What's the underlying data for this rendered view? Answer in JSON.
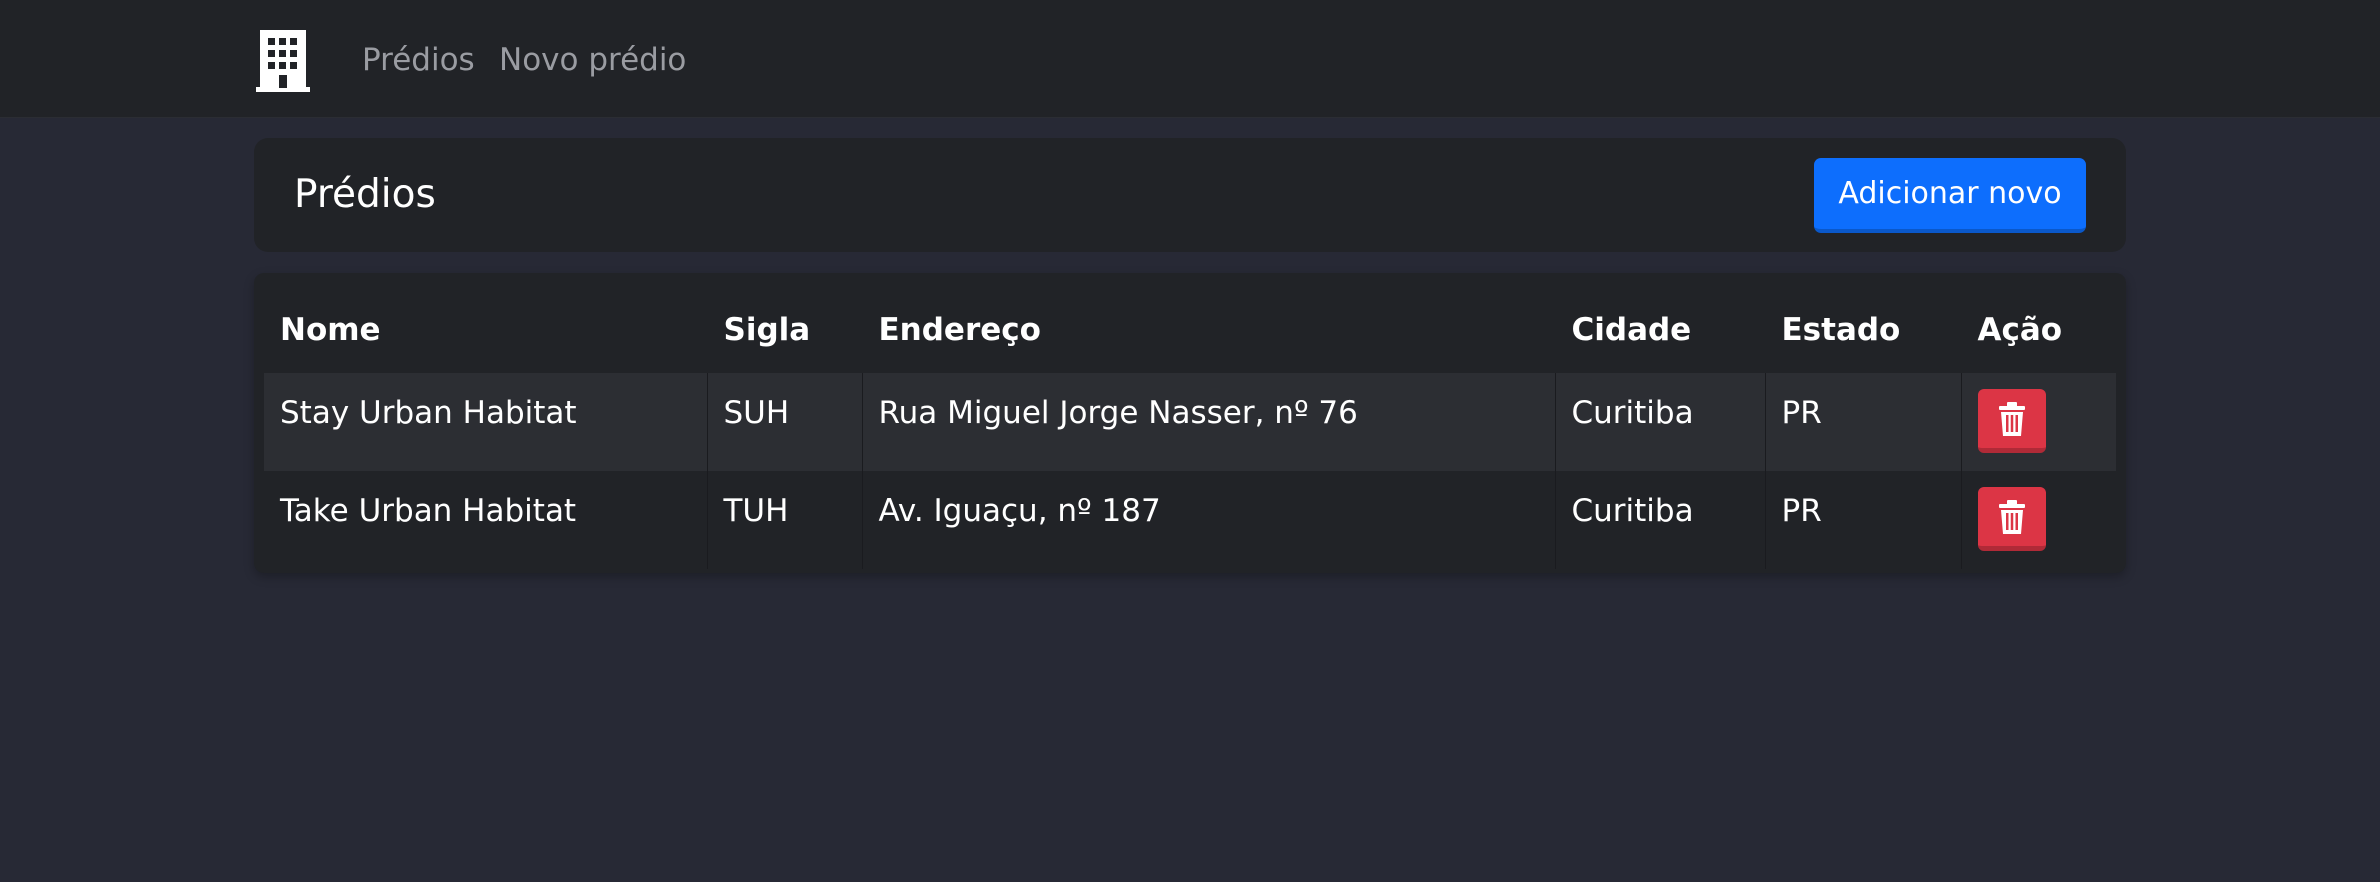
{
  "nav": {
    "brand_icon": "building-icon",
    "links": [
      "Prédios",
      "Novo prédio"
    ]
  },
  "header": {
    "title": "Prédios",
    "add_button_label": "Adicionar novo"
  },
  "table": {
    "columns": [
      "Nome",
      "Sigla",
      "Endereço",
      "Cidade",
      "Estado",
      "Ação"
    ],
    "rows": [
      {
        "nome": "Stay Urban Habitat",
        "sigla": "SUH",
        "endereco": "Rua Miguel Jorge Nasser, nº 76",
        "cidade": "Curitiba",
        "estado": "PR",
        "acao_icon": "trash-icon"
      },
      {
        "nome": "Take Urban Habitat",
        "sigla": "TUH",
        "endereco": "Av. Iguaçu, nº 187",
        "cidade": "Curitiba",
        "estado": "PR",
        "acao_icon": "trash-icon"
      }
    ]
  },
  "colors": {
    "page_bg": "#272935",
    "navbar_bg": "#212327",
    "card_bg": "#212327",
    "primary": "#0d6efd",
    "danger": "#dc3545",
    "nav_link": "#9a9ca2"
  }
}
